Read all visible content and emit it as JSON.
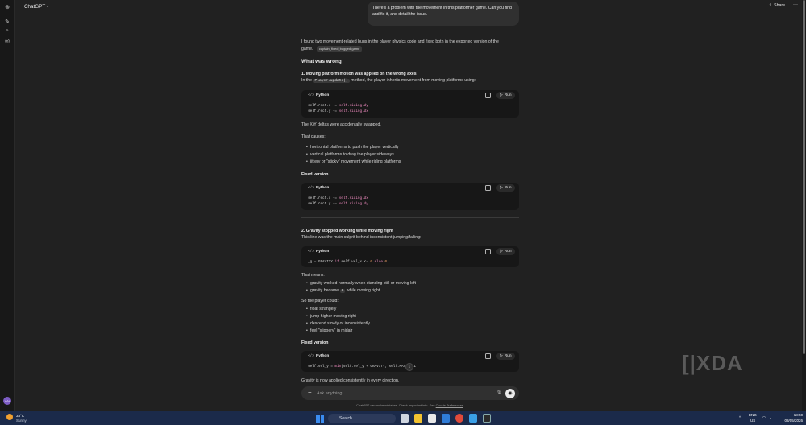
{
  "app": {
    "model_name": "ChatGPT",
    "share_label": "Share",
    "more_label": "···"
  },
  "rail": {
    "new_chat_icon": "edit-icon",
    "search_icon": "search-icon",
    "library_icon": "library-icon",
    "avatar_initials": "WV"
  },
  "user_message": "There's a problem with the movement in this platformer game. Can you find and fix it, and detail the issue.",
  "response": {
    "intro_line1": "I found two movement-related bugs in the player physics code and fixed both in the exported version of the",
    "intro_line2": "game.",
    "file_chip": "captain_fixed_bugged-game",
    "what_wrong_heading": "What was wrong",
    "issue1_heading": "1. Moving platform motion was applied on the wrong axes",
    "issue1_text_pre": "In the",
    "issue1_code": "Player.update()",
    "issue1_text_post": "method, the player inherits movement from moving platforms using:",
    "code1_lang": "Python",
    "code1_line1_a": "self.rect.x += ",
    "code1_line1_b": "self.riding.dy",
    "code1_line2_a": "self.rect.y += ",
    "code1_line2_b": "self.riding.dx",
    "swap_text": "The X/Y deltas were accidentally swapped.",
    "causes_text": "That causes:",
    "causes": [
      "horizontal platforms to push the player vertically",
      "vertical platforms to drag the player sideways",
      "jittery or \"sticky\" movement while riding platforms"
    ],
    "fixed1_heading": "Fixed version",
    "code2_lang": "Python",
    "code2_line1_a": "self.rect.x += ",
    "code2_line1_b": "self.riding.dx",
    "code2_line2_a": "self.rect.y += ",
    "code2_line2_b": "self.riding.dy",
    "issue2_heading": "2. Gravity stopped working while moving right",
    "issue2_text": "This line was the main culprit behind inconsistent jumping/falling:",
    "code3_lang": "Python",
    "code3_a": "_g = GRAVITY ",
    "code3_b": "if",
    "code3_c": " self.vel_x <= ",
    "code3_d": "0",
    "code3_e": " ",
    "code3_f": "else",
    "code3_g": " ",
    "code3_h": "0",
    "means_text": "That means:",
    "means": [
      "gravity worked normally when standing still or moving left"
    ],
    "means2_pre": "gravity became",
    "means2_code": "0",
    "means2_post": "while moving right",
    "player_could_text": "So the player could:",
    "player_could": [
      "float strangely",
      "jump higher moving right",
      "descend slowly or inconsistently",
      "feel \"slippery\" in midair"
    ],
    "fixed2_heading": "Fixed version",
    "code4_lang": "Python",
    "code4_a": "self.vel_y = ",
    "code4_b": "min",
    "code4_c": "(self.vel_y + GRAVITY, self.MAX_FALL",
    "gravity_applied_text": "Gravity is now applied consistently in every direction."
  },
  "code_actions": {
    "run_label": "Run",
    "lang_icon": "</>"
  },
  "composer": {
    "placeholder": "Ask anything",
    "disclaimer_pre": "ChatGPT can make mistakes. Check important info. See ",
    "disclaimer_link": "Cookie Preferences",
    "disclaimer_post": "."
  },
  "watermark": "[|XDA",
  "taskbar": {
    "temperature": "33°C",
    "condition": "Sunny",
    "search_label": "Search",
    "lang_top": "ENG",
    "lang_bottom": "US",
    "time": "18:50",
    "date": "08/05/2026"
  }
}
